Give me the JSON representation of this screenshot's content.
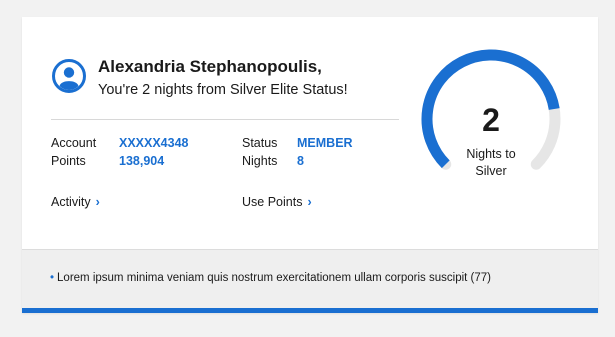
{
  "colors": {
    "accent": "#1a6fd1",
    "track": "#e6e6e6",
    "footer_bg": "#efefef"
  },
  "profile": {
    "avatar_icon": "user-avatar-icon",
    "name": "Alexandria Stephanopoulis,",
    "tagline": "You're 2 nights from Silver Elite Status!"
  },
  "account": {
    "account_label": "Account",
    "account_value": "XXXXX4348",
    "points_label": "Points",
    "points_value": "138,904",
    "status_label": "Status",
    "status_value": "MEMBER",
    "nights_label": "Nights",
    "nights_value": "8"
  },
  "links": {
    "activity": "Activity",
    "use_points": "Use Points",
    "chevron_icon": "chevron-right-icon"
  },
  "gauge": {
    "number": "2",
    "label_line1": "Nights to",
    "label_line2": "Silver",
    "progress": 0.8
  },
  "footer": {
    "text": "Lorem ipsum minima veniam quis nostrum exercitationem ullam corporis suscipit (77)"
  }
}
